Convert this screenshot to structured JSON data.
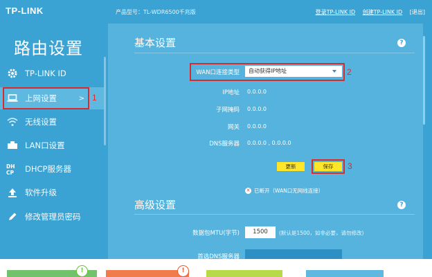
{
  "header": {
    "logo": "TP-LINK",
    "model": "产品型号：TL-WDR6500千兆版",
    "login": "登录TP-LINK ID",
    "create": "创建TP-LINK ID",
    "close": "[退出]"
  },
  "sidebar": {
    "title": "路由设置",
    "items": [
      {
        "label": "TP-LINK ID",
        "icon": "gear-icon"
      },
      {
        "label": "上网设置",
        "icon": "laptop-icon",
        "arrow": ">"
      },
      {
        "label": "无线设置",
        "icon": "wifi-icon"
      },
      {
        "label": "LAN口设置",
        "icon": "lan-icon"
      },
      {
        "label": "DHCP服务器",
        "icon": "dhcp-icon"
      },
      {
        "label": "软件升级",
        "icon": "upload-icon"
      },
      {
        "label": "修改管理员密码",
        "icon": "pencil-icon"
      }
    ],
    "annotation": "1"
  },
  "basic": {
    "title": "基本设置",
    "help": "?",
    "wan_label": "WAN口连接类型",
    "wan_value": "自动获得IP地址",
    "wan_annotation": "2",
    "fields": [
      {
        "label": "IP地址",
        "value": "0.0.0.0"
      },
      {
        "label": "子网掩码",
        "value": "0.0.0.0"
      },
      {
        "label": "网关",
        "value": "0.0.0.0"
      },
      {
        "label": "DNS服务器",
        "value": "0.0.0.0 , 0.0.0.0"
      }
    ],
    "refresh": "更新",
    "save": "保存",
    "save_annotation": "3",
    "status": "已断开（WAN口无网线连接）"
  },
  "advanced": {
    "title": "高级设置",
    "help": "?",
    "mtu_label": "数据包MTU(字节)",
    "mtu_value": "1500",
    "mtu_hint": "(默认是1500，如非必要，请勿修改)",
    "dns_label": "首选DNS服务器"
  },
  "bottom": {
    "badge1": "!",
    "badge2": "!"
  },
  "colors": {
    "accent": "#3aa3d4",
    "panel": "#55b3dd",
    "button": "#ffe62b",
    "annotation": "#d92b2b"
  }
}
